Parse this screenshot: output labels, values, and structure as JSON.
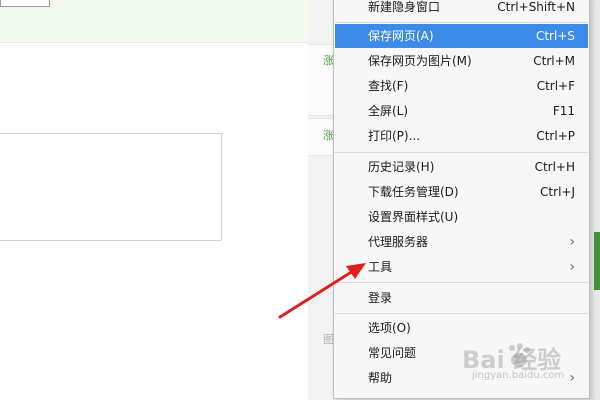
{
  "background": {
    "strip_green_1": "涨",
    "strip_green_2": "涨",
    "strip_grey": "图"
  },
  "menu": {
    "items": [
      {
        "label": "新建隐身窗口",
        "shortcut": "Ctrl+Shift+N"
      },
      {
        "label": "保存网页(A)",
        "shortcut": "Ctrl+S"
      },
      {
        "label": "保存网页为图片(M)",
        "shortcut": "Ctrl+M"
      },
      {
        "label": "查找(F)",
        "shortcut": "Ctrl+F"
      },
      {
        "label": "全屏(L)",
        "shortcut": "F11"
      },
      {
        "label": "打印(P)...",
        "shortcut": "Ctrl+P"
      },
      {
        "label": "历史记录(H)",
        "shortcut": "Ctrl+H"
      },
      {
        "label": "下载任务管理(D)",
        "shortcut": "Ctrl+J"
      },
      {
        "label": "设置界面样式(U)",
        "shortcut": ""
      },
      {
        "label": "代理服务器",
        "shortcut": ""
      },
      {
        "label": "工具",
        "shortcut": ""
      },
      {
        "label": "登录",
        "shortcut": ""
      },
      {
        "label": "选项(O)",
        "shortcut": ""
      },
      {
        "label": "常见问题",
        "shortcut": ""
      },
      {
        "label": "帮助",
        "shortcut": ""
      }
    ],
    "highlight_color": "#3c8be8"
  },
  "annotation": {
    "arrow_color": "#e02020"
  },
  "watermark": {
    "brand": "Bai 经验",
    "sub": "jingyan.baidu.com"
  }
}
